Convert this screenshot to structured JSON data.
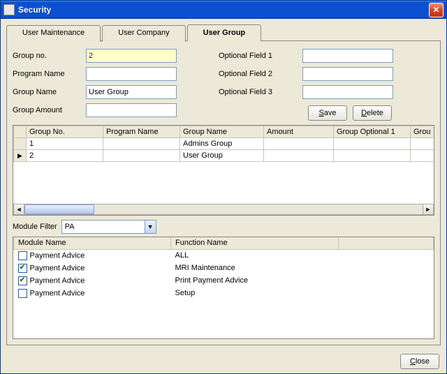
{
  "window": {
    "title": "Security"
  },
  "tabs": [
    {
      "label": "User Maintenance",
      "active": false
    },
    {
      "label": "User Company",
      "active": false
    },
    {
      "label": "User Group",
      "active": true
    }
  ],
  "form": {
    "labels": {
      "group_no": "Group no.",
      "program_name": "Program Name",
      "group_name": "Group Name",
      "group_amount": "Group Amount",
      "opt1": "Optional Field 1",
      "opt2": "Optional Field 2",
      "opt3": "Optional Field 3"
    },
    "values": {
      "group_no": "2",
      "program_name": "",
      "group_name": "User Group",
      "group_amount": "",
      "opt1": "",
      "opt2": "",
      "opt3": ""
    }
  },
  "buttons": {
    "save": "Save",
    "save_accel": "S",
    "delete": "Delete",
    "delete_accel": "D",
    "close": "Close",
    "close_accel": "C"
  },
  "grid": {
    "columns": [
      "Group No.",
      "Program Name",
      "Group Name",
      "Amount",
      "Group Optional 1",
      "Grou"
    ],
    "rows": [
      {
        "selected": false,
        "cells": [
          "1",
          "",
          "Admins Group",
          "",
          "",
          ""
        ]
      },
      {
        "selected": true,
        "cells": [
          "2",
          "",
          "User Group",
          "",
          "",
          ""
        ]
      }
    ]
  },
  "filter": {
    "label": "Module Filter",
    "value": "PA"
  },
  "func_table": {
    "columns": [
      "Module Name",
      "Function Name",
      ""
    ],
    "rows": [
      {
        "checked": false,
        "module": "Payment Advice",
        "function": "ALL"
      },
      {
        "checked": true,
        "module": "Payment Advice",
        "function": "MRI Maintenance"
      },
      {
        "checked": true,
        "module": "Payment Advice",
        "function": "Print Payment Advice"
      },
      {
        "checked": false,
        "module": "Payment Advice",
        "function": "Setup"
      }
    ]
  }
}
